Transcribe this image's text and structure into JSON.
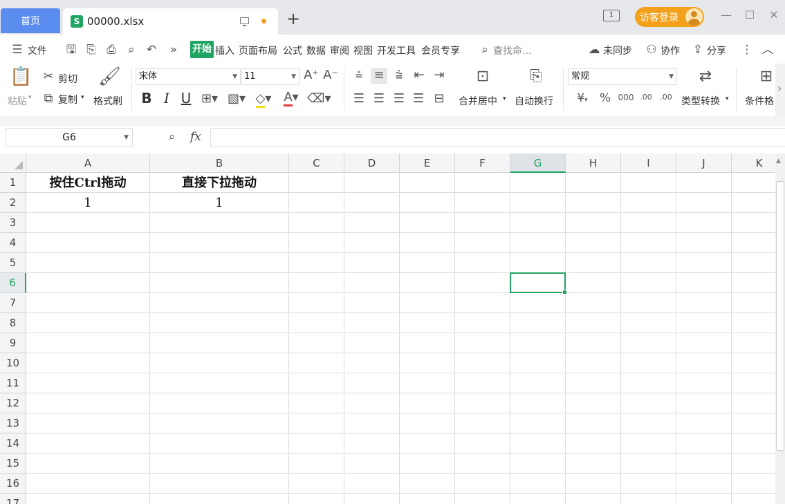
{
  "titlebar": {
    "home_tab": "首页",
    "file_icon": "S",
    "file_name": "00000.xlsx",
    "new_tab": "+",
    "screen_badge": "1",
    "login_label": "访客登录",
    "accent": "#1fa462",
    "login_color": "#f3a11b"
  },
  "menu": {
    "file": "文件",
    "tabs": [
      "开始",
      "插入",
      "页面布局",
      "公式",
      "数据",
      "审阅",
      "视图",
      "开发工具",
      "会员专享"
    ],
    "search": "查找命...",
    "sync": "未同步",
    "collab": "协作",
    "share": "分享"
  },
  "ribbon": {
    "paste": "粘贴",
    "cut": "剪切",
    "copy": "复制",
    "format_painter": "格式刷",
    "font_name": "宋体",
    "font_size": "11",
    "bold": "B",
    "italic": "I",
    "underline": "U",
    "font_color_glyph": "A",
    "merge_center": "合并居中",
    "wrap_text": "自动换行",
    "number_format": "常规",
    "currency": "¥",
    "percent": "%",
    "thousands": "000",
    "inc_decimal": ".00",
    "dec_decimal": ".00",
    "type_convert": "类型转换",
    "conditional": "条件格"
  },
  "formula_bar": {
    "name_box": "G6",
    "fx": "fx",
    "value": ""
  },
  "sheet": {
    "columns": [
      "A",
      "B",
      "C",
      "D",
      "E",
      "F",
      "G",
      "H",
      "I",
      "J",
      "K"
    ],
    "rows": [
      "1",
      "2",
      "3",
      "4",
      "5",
      "6",
      "7",
      "8",
      "9",
      "10",
      "11",
      "12",
      "13",
      "14",
      "15",
      "16",
      "17"
    ],
    "selected_column": "G",
    "selected_row": "6",
    "cells": {
      "A1": "按住Ctrl拖动",
      "B1": "直接下拉拖动",
      "A2": "1",
      "B2": "1"
    }
  }
}
